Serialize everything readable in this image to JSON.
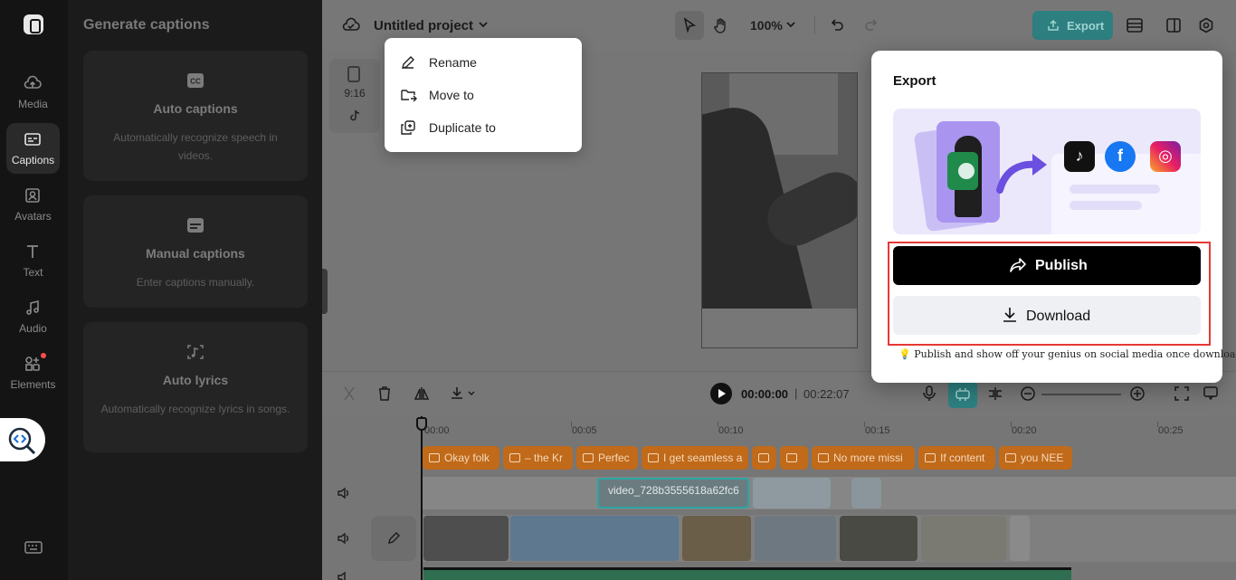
{
  "rail": {
    "items": [
      {
        "label": "Media",
        "icon": "cloud-upload-icon"
      },
      {
        "label": "Captions",
        "icon": "captions-icon"
      },
      {
        "label": "Avatars",
        "icon": "avatar-icon"
      },
      {
        "label": "Text",
        "icon": "text-icon"
      },
      {
        "label": "Audio",
        "icon": "music-note-icon"
      },
      {
        "label": "Elements",
        "icon": "elements-icon"
      }
    ],
    "active": "Captions"
  },
  "panel": {
    "title": "Generate captions",
    "cards": [
      {
        "title": "Auto captions",
        "desc": "Automatically recognize speech in videos."
      },
      {
        "title": "Manual captions",
        "desc": "Enter captions manually."
      },
      {
        "title": "Auto lyrics",
        "desc": "Automatically recognize lyrics in songs."
      }
    ]
  },
  "topbar": {
    "project_name": "Untitled project",
    "zoom": "100%",
    "export_label": "Export"
  },
  "project_menu": {
    "items": [
      {
        "label": "Rename",
        "icon": "pencil-icon"
      },
      {
        "label": "Move to",
        "icon": "folder-move-icon"
      },
      {
        "label": "Duplicate to",
        "icon": "duplicate-icon"
      }
    ]
  },
  "canvas": {
    "ratio": "9:16"
  },
  "timeline": {
    "current_time": "00:00:00",
    "separator": "|",
    "total_time": "00:22:07",
    "ruler": [
      "00:00",
      "00:05",
      "00:10",
      "00:15",
      "00:20",
      "00:25"
    ],
    "caption_clips": [
      "Okay folk",
      "– the Kr",
      "Perfec",
      "I get seamless a",
      "",
      "",
      "No more missi",
      "If content",
      "you NEE"
    ],
    "video_clip_name": "video_728b3555618a62fc6"
  },
  "export_panel": {
    "title": "Export",
    "publish_label": "Publish",
    "download_label": "Download",
    "tip": "Publish and show off your genius on social media once downloaded.",
    "highlight_color": "#e53935"
  },
  "colors": {
    "accent": "#2d7f80",
    "caption_clip": "#c06a1a"
  }
}
